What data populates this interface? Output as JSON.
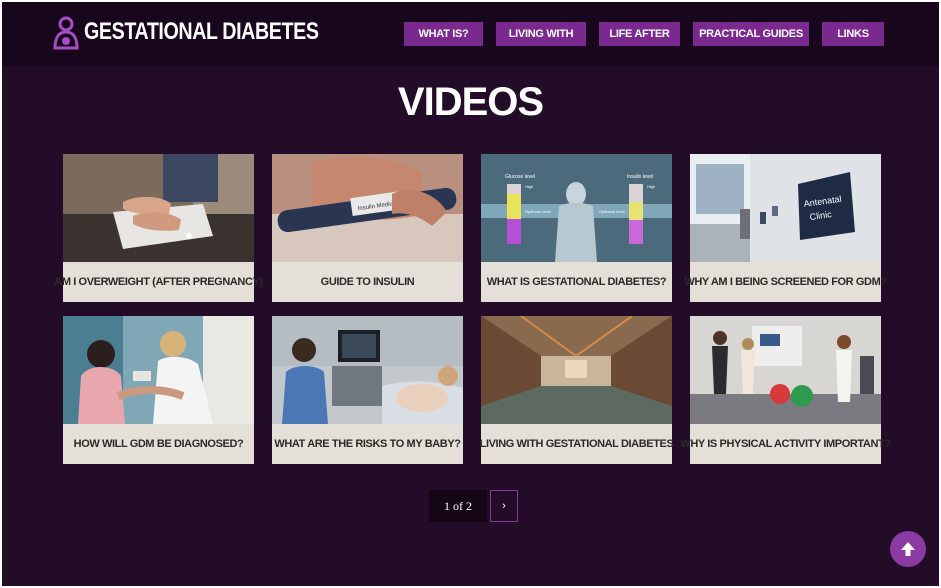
{
  "brand": {
    "title": "GESTATIONAL DIABETES",
    "icon": "mother-baby-icon"
  },
  "nav": [
    {
      "label": "WHAT IS?"
    },
    {
      "label": "LIVING WITH"
    },
    {
      "label": "LIFE AFTER"
    },
    {
      "label": "PRACTICAL GUIDES"
    },
    {
      "label": "LINKS"
    }
  ],
  "page": {
    "title": "VIDEOS"
  },
  "videos": [
    {
      "title": "AM I OVERWEIGHT (AFTER PREGNANCY)",
      "thumbnail": "scale-feet"
    },
    {
      "title": "GUIDE TO INSULIN",
      "thumbnail": "insulin-pen"
    },
    {
      "title": "WHAT IS GESTATIONAL DIABETES?",
      "thumbnail": "glucose-insulin-levels"
    },
    {
      "title": "WHY AM I BEING SCREENED FOR GDM?",
      "thumbnail": "antenatal-clinic"
    },
    {
      "title": "HOW WILL GDM BE DIAGNOSED?",
      "thumbnail": "blood-test"
    },
    {
      "title": "WHAT ARE THE RISKS TO MY BABY?",
      "thumbnail": "ultrasound"
    },
    {
      "title": "LIVING WITH GESTATIONAL DIABETES",
      "thumbnail": "swimming-pool"
    },
    {
      "title": "WHY IS PHYSICAL ACTIVITY IMPORTANT?",
      "thumbnail": "exercise-class"
    }
  ],
  "thumb_text": {
    "glucose_label": "Glucose level",
    "insulin_label": "Insulin level",
    "high": "High",
    "optimum": "Optimum level",
    "clinic_sign": [
      "Antenatal",
      "Clinic"
    ],
    "pen_label": "Insulin Medium"
  },
  "pagination": {
    "label": "1 of 2",
    "next": "›"
  },
  "back_to_top": {
    "icon": "arrow-up-icon"
  },
  "colors": {
    "background": "#230c28",
    "header": "#18061c",
    "accent": "#7a2a8f",
    "caption_bg": "#e4e0d8"
  }
}
